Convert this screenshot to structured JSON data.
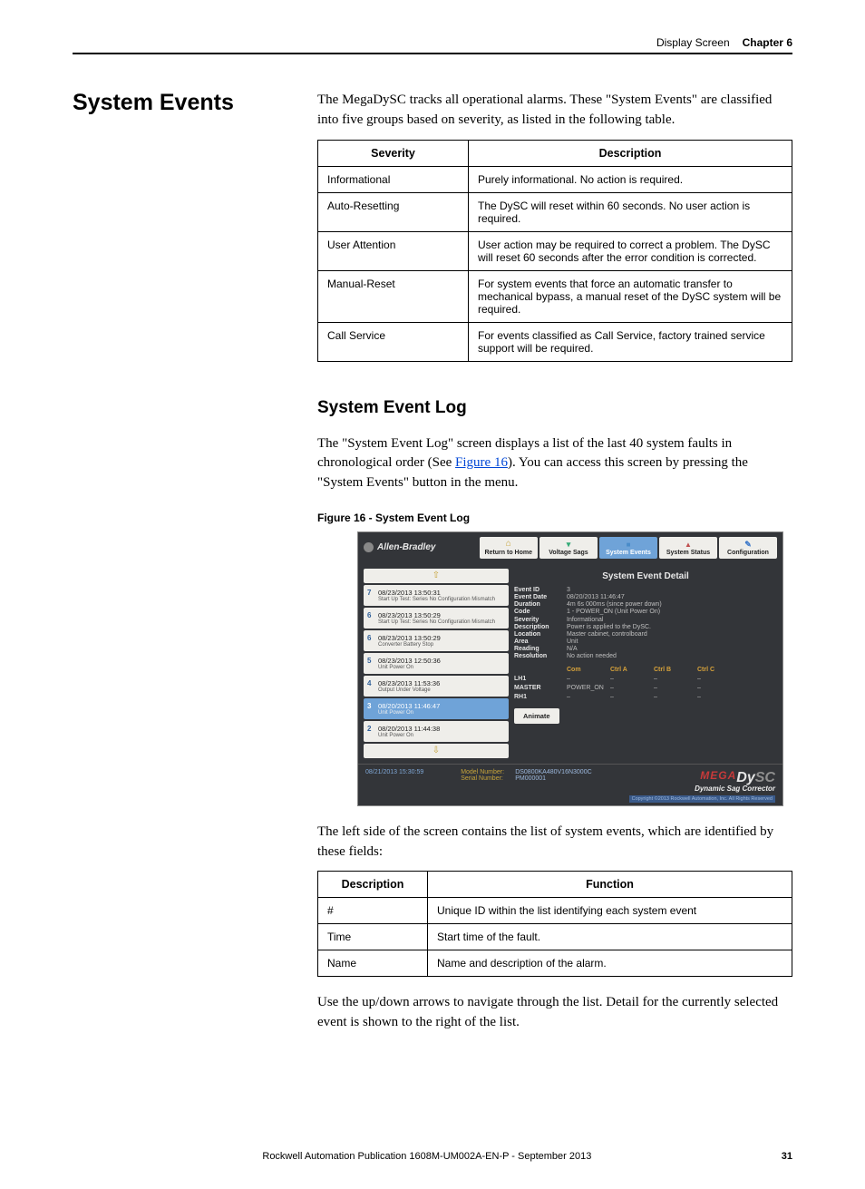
{
  "header": {
    "subject": "Display Screen",
    "chapter": "Chapter 6"
  },
  "section_title": "System Events",
  "intro": "The MegaDySC tracks all operational alarms. These \"System Events\" are classified into five groups based on severity, as listed in the following table.",
  "severity_table": {
    "headers": [
      "Severity",
      "Description"
    ],
    "rows": [
      [
        "Informational",
        "Purely informational. No action is required."
      ],
      [
        "Auto-Resetting",
        "The DySC will reset within 60 seconds. No user action is required."
      ],
      [
        "User Attention",
        "User action may be required to correct a problem. The DySC will reset 60 seconds after the error condition is corrected."
      ],
      [
        "Manual-Reset",
        "For system events that force an automatic transfer to mechanical bypass, a manual reset of the DySC system will be required."
      ],
      [
        "Call Service",
        "For events classified as Call Service, factory trained service support will be required."
      ]
    ]
  },
  "subhead": "System Event Log",
  "log_intro_a": "The \"System Event Log\" screen displays a list of the last 40 system faults in chronological order (See ",
  "log_intro_link": "Figure 16",
  "log_intro_b": "). You can access this screen by pressing the \"System Events\" button in the menu.",
  "fig_caption": "Figure 16 - System Event Log",
  "screenshot": {
    "brand": "Allen-Bradley",
    "tabs": {
      "home": "Return to Home",
      "vs": "Voltage Sags",
      "se": "System Events",
      "ss": "System Status",
      "cf": "Configuration"
    },
    "nav_up": "⇧",
    "nav_dn": "⇩",
    "events": [
      {
        "n": "7",
        "ts": "08/23/2013 13:50:31",
        "d": "Start Up Test: Series No Configuration Mismatch"
      },
      {
        "n": "6",
        "ts": "08/23/2013 13:50:29",
        "d": "Start Up Test: Series No Configuration Mismatch"
      },
      {
        "n": "6",
        "ts": "08/23/2013 13:50:29",
        "d": "Converter Battery Stop"
      },
      {
        "n": "5",
        "ts": "08/23/2013 12:50:36",
        "d": "Unit Power On"
      },
      {
        "n": "4",
        "ts": "08/23/2013 11:53:36",
        "d": "Output Under Voltage"
      },
      {
        "n": "3",
        "ts": "08/20/2013 11:46:47",
        "d": "Unit Power On"
      },
      {
        "n": "2",
        "ts": "08/20/2013 11:44:38",
        "d": "Unit Power On"
      }
    ],
    "selected_index": 5,
    "detail_title": "System Event Detail",
    "detail": {
      "Event ID": "3",
      "Event Date": "08/20/2013 11:46:47",
      "Duration": "4m 6s 000ms (since power down)",
      "Code": "1 - POWER_ON (Unit Power On)",
      "Severity": "Informational",
      "Description": "Power is applied to the DySC.",
      "Location": "Master cabinet, controlboard",
      "Area": "Unit",
      "Reading": "N/A",
      "Resolution": "No action needed"
    },
    "cab_headers": [
      "",
      "Com",
      "Ctrl A",
      "Ctrl B",
      "Ctrl C"
    ],
    "cab_rows": [
      [
        "LH1",
        "–",
        "–",
        "–",
        "–"
      ],
      [
        "MASTER",
        "POWER_ON",
        "–",
        "–",
        "–"
      ],
      [
        "RH1",
        "–",
        "–",
        "–",
        "–"
      ]
    ],
    "animate": "Animate",
    "footer_ts": "08/21/2013 15:30:59",
    "model_label": "Model Number:",
    "model_value": "DS0800KA480V16N3000C",
    "serial_label": "Serial Number:",
    "serial_value": "PM000001",
    "brand_mega": "MEGA",
    "brand_dy": "Dy",
    "brand_sc": "SC",
    "tagline": "Dynamic Sag Corrector",
    "copyright": "Copyright ©2013 Rockwell Automation, Inc. All Rights Reserved"
  },
  "left_side_text": "The left side of the screen contains the list of system events, which are identified by these fields:",
  "fields_table": {
    "headers": [
      "Description",
      "Function"
    ],
    "rows": [
      [
        "#",
        "Unique ID within the list identifying each system event"
      ],
      [
        "Time",
        "Start time of the fault."
      ],
      [
        "Name",
        "Name and description of the alarm."
      ]
    ]
  },
  "nav_text": "Use the up/down arrows to navigate through the list. Detail for the currently selected event is shown to the right of the list.",
  "footer": {
    "pub": "Rockwell Automation Publication 1608M-UM002A-EN-P - September 2013",
    "page": "31"
  },
  "chart_data": null
}
